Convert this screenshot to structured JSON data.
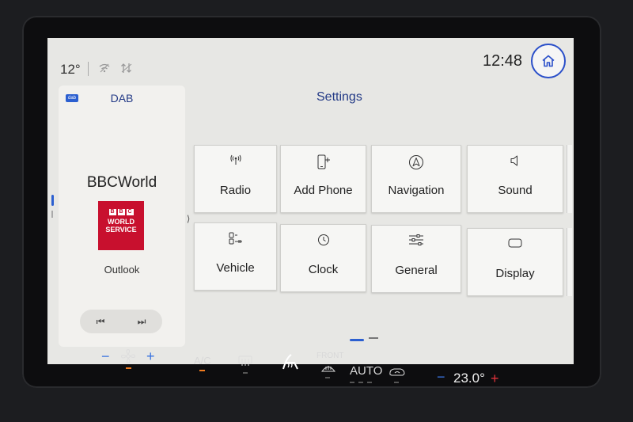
{
  "status": {
    "temperature": "12°",
    "time": "12:48",
    "icons": [
      "wifi-off-icon",
      "data-transfer-icon"
    ]
  },
  "media": {
    "badge": "dab",
    "source": "DAB",
    "station": "BBCWorld",
    "logo_letters": [
      "B",
      "B",
      "C"
    ],
    "logo_line1": "WORLD",
    "logo_line2": "SERVICE",
    "programme": "Outlook",
    "prev_icon": "⏮",
    "next_icon": "⏭"
  },
  "settings": {
    "title": "Settings",
    "tiles": [
      {
        "label": "Radio",
        "icon": "antenna-icon"
      },
      {
        "label": "Add Phone",
        "icon": "add-phone-icon"
      },
      {
        "label": "Navigation",
        "icon": "navigation-icon"
      },
      {
        "label": "Sound",
        "icon": "speaker-icon"
      },
      {
        "label": "Vehicle",
        "icon": "vehicle-icon"
      },
      {
        "label": "Clock",
        "icon": "clock-icon"
      },
      {
        "label": "General",
        "icon": "sliders-icon"
      },
      {
        "label": "Display",
        "icon": "display-icon"
      }
    ]
  },
  "climate": {
    "minus": "−",
    "plus": "+",
    "ac_label": "A/C",
    "front_label": "FRONT",
    "auto_label": "AUTO",
    "set_temp": "23.0°"
  },
  "colors": {
    "accent": "#2b5fd0",
    "title_blue": "#233a86",
    "bbc_red": "#c8102e",
    "led_amber": "#f07b1f"
  }
}
